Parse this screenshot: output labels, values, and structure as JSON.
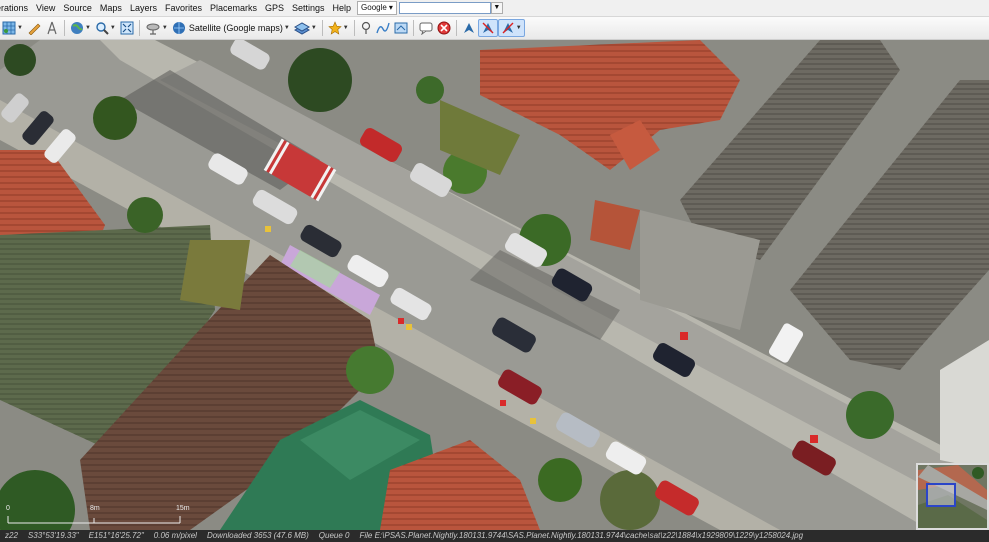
{
  "menu": {
    "items": [
      "erations",
      "View",
      "Source",
      "Maps",
      "Layers",
      "Favorites",
      "Placemarks",
      "GPS",
      "Settings",
      "Help"
    ],
    "search_provider": "Google",
    "search_value": "",
    "search_go": "▼"
  },
  "toolbar": {
    "map_type_label": "Satellite (Google maps)",
    "icons": [
      "grid-layer-icon",
      "pencil-ruler-icon",
      "compass-distance-icon",
      "globe-icon",
      "zoom-icon",
      "fullscreen-icon",
      "satellite-dish-icon",
      "map-source-globe-icon",
      "layer-overlay-icon",
      "favorite-star-icon",
      "placemark-pin-icon",
      "path-icon",
      "polygon-icon",
      "message-icon",
      "stop-icon",
      "gps-track-icon",
      "gps-center-icon",
      "gps-settings-icon"
    ]
  },
  "scale": {
    "labels": [
      "0",
      "8m",
      "15m"
    ]
  },
  "status": {
    "zoom": "z22",
    "lat": "S33°53'19.33\"",
    "lon": "E151°16'25.72\"",
    "resolution": "0.06 m/pixel",
    "downloaded": "Downloaded 3653 (47.6 MB)",
    "queue": "Queue 0",
    "file": "File E:\\PSAS.Planet.Nightly.180131.9744\\SAS.Planet.Nightly.180131.9744\\cache\\sat\\z22\\1884\\x1929809\\1229\\y1258024.jpg"
  },
  "colors": {
    "menubar": "#f0f0f0",
    "statusbar": "#2b2b2b",
    "road": "#9a9a94",
    "minimap_selection": "#2b45c8"
  }
}
